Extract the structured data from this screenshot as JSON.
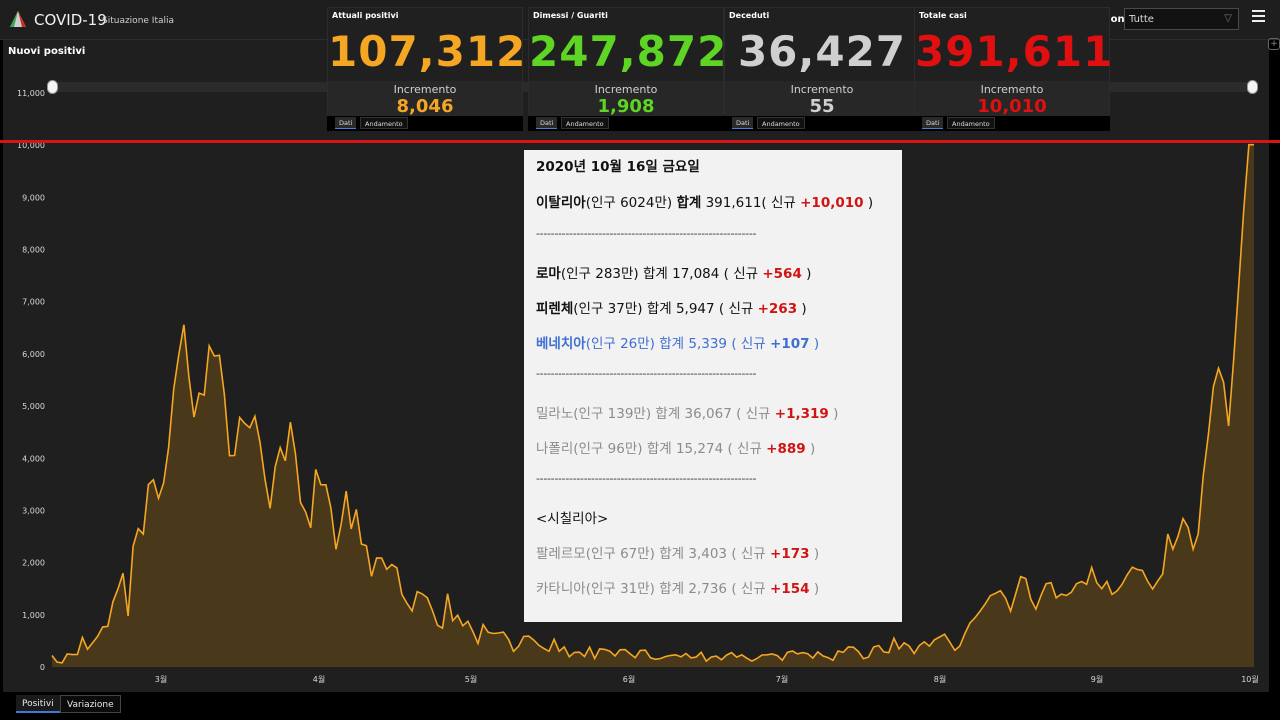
{
  "header": {
    "title": "COVID-19",
    "subtitle": "Situazione Italia",
    "region_label": "gione",
    "region_value": "Tutte"
  },
  "chart": {
    "title": "Nuovi positivi"
  },
  "cards": [
    {
      "label": "Attuali positivi",
      "value": "107,312",
      "inc_label": "Incremento",
      "inc_value": "8,046",
      "color": "#f5a623",
      "tab_dati": "Dati",
      "tab_andamento": "Andamento"
    },
    {
      "label": "Dimessi / Guariti",
      "value": "247,872",
      "inc_label": "Incremento",
      "inc_value": "1,908",
      "color": "#5ed424",
      "tab_dati": "Dati",
      "tab_andamento": "Andamento"
    },
    {
      "label": "Deceduti",
      "value": "36,427",
      "inc_label": "Incremento",
      "inc_value": "55",
      "color": "#cfcfcf",
      "tab_dati": "Dati",
      "tab_andamento": "Andamento"
    },
    {
      "label": "Totale casi",
      "value": "391,611",
      "inc_label": "Incremento",
      "inc_value": "10,010",
      "color": "#e01010",
      "tab_dati": "Dati",
      "tab_andamento": "Andamento"
    }
  ],
  "overlay": {
    "date": "2020년 10월 16일 금요일",
    "italy": {
      "name": "이탈리아",
      "pop": "(인구 6024만)",
      "total_label": "합계",
      "total": "391,611",
      "new_label": "( 신규",
      "new": "+10,010",
      "close": ")"
    },
    "separator": "------------------------------------------------------------",
    "cities": [
      {
        "name": "로마",
        "pop": "(인구 283만)",
        "rest": " 합계 17,084 ( 신규 ",
        "new": "+564",
        "close": ")"
      },
      {
        "name": "피렌체",
        "pop": "(인구 37만)",
        "rest": " 합계 5,947 ( 신규 ",
        "new": "+263",
        "close": ")"
      },
      {
        "name": "베네치아",
        "pop": "(인구 26만)",
        "rest": " 합계 5,339 ( 신규 ",
        "new": "+107",
        "close": ")"
      },
      {
        "name": "밀라노",
        "pop": "(인구 139만)",
        "rest": " 합계 36,067 ( 신규 ",
        "new": "+1,319",
        "close": ")"
      },
      {
        "name": "나폴리",
        "pop": "(인구 96만)",
        "rest": " 합계 15,274 ( 신규 ",
        "new": "+889",
        "close": ")"
      },
      {
        "name": "팔레르모",
        "pop": "(인구 67만)",
        "rest": " 합계 3,403 ( 신규 ",
        "new": "+173",
        "close": ")"
      },
      {
        "name": "카타니아",
        "pop": "(인구 31만)",
        "rest": " 합계 2,736 ( 신규 ",
        "new": "+154",
        "close": ")"
      }
    ],
    "sicily": "<시칠리아>"
  },
  "bottom_tabs": [
    "Positivi",
    "Variazione"
  ],
  "chart_data": {
    "type": "area",
    "title": "Nuovi positivi",
    "ylim": [
      0,
      11000
    ],
    "y_ticks": [
      "0",
      "1,000",
      "2,000",
      "3,000",
      "4,000",
      "5,000",
      "6,000",
      "7,000",
      "8,000",
      "9,000",
      "10,000",
      "11,000"
    ],
    "x_ticks": [
      "3월",
      "4월",
      "5월",
      "6월",
      "7월",
      "8월",
      "9월",
      "10월"
    ],
    "series": [
      {
        "values": [
          221,
          93,
          78,
          250,
          238,
          240,
          566,
          342,
          466,
          587,
          769,
          778,
          1247,
          1492,
          1797,
          977,
          2313,
          2651,
          2547,
          3497,
          3590,
          3233,
          3526,
          4207,
          5322,
          5986,
          6557,
          5560,
          4789,
          5249,
          5210,
          6153,
          5959,
          5974,
          5217,
          4050,
          4053,
          4782,
          4668,
          4585,
          4805,
          4316,
          3599,
          3039,
          3836,
          4204,
          3951,
          4694,
          4092,
          3153,
          2972,
          2667,
          3786,
          3493,
          3491,
          3047,
          2256,
          2729,
          3370,
          2646,
          3021,
          2357,
          2324,
          1739,
          2091,
          2086,
          1872,
          1965,
          1900,
          1389,
          1221,
          1075,
          1444,
          1401,
          1327,
          1083,
          802,
          744,
          1402,
          888,
          992,
          789,
          875,
          675,
          451,
          813,
          665,
          642,
          652,
          669,
          531,
          300,
          397,
          584,
          593,
          516,
          416,
          355,
          300,
          531,
          300,
          385,
          197,
          280,
          283,
          202,
          379,
          163,
          346,
          338,
          303,
          210,
          329,
          333,
          251,
          178,
          318,
          321,
          177,
          148,
          162,
          201,
          223,
          234,
          193,
          259,
          175,
          190,
          282,
          114,
          192,
          208,
          138,
          229,
          276,
          188,
          234,
          169,
          114,
          163,
          230,
          233,
          249,
          218,
          128,
          282,
          306,
          252,
          275,
          255,
          170,
          289,
          212,
          181,
          128,
          306,
          280,
          386,
          379,
          295,
          159,
          190,
          384,
          412,
          289,
          274,
          552,
          347,
          463,
          402,
          259,
          412,
          481,
          401,
          522,
          574,
          629,
          479,
          320,
          403,
          642,
          845,
          947,
          1071,
          1210,
          1367,
          1411,
          1462,
          1320,
          1071,
          1397,
          1733,
          1694,
          1297,
          1108,
          1370,
          1597,
          1616,
          1326,
          1397,
          1370,
          1434,
          1597,
          1638,
          1585,
          1907,
          1616,
          1501,
          1640,
          1392,
          1458,
          1587,
          1766,
          1912,
          1869,
          1850,
          1648,
          1494,
          1644,
          1785,
          2548,
          2257,
          2499,
          2844,
          2677,
          2257,
          2548,
          3677,
          4458,
          5372,
          5724,
          5456,
          4619,
          5901,
          7332,
          8804,
          10010,
          10010
        ]
      }
    ],
    "color": "#f5a623",
    "grid": false
  }
}
